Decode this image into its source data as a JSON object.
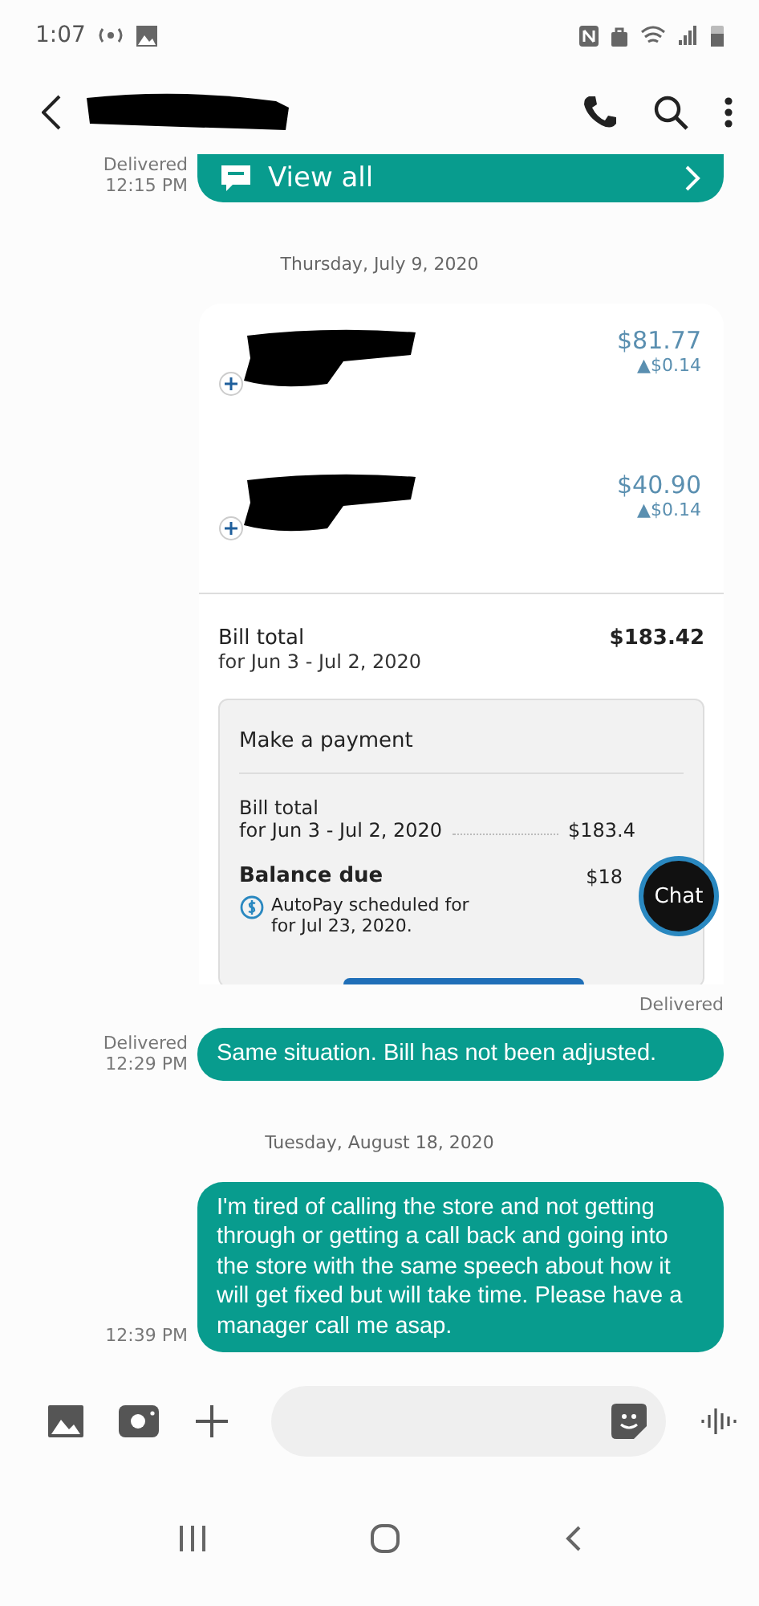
{
  "status_bar": {
    "time": "1:07"
  },
  "messages": [
    {
      "kind": "link",
      "label": "View all",
      "status": "Delivered",
      "time": "12:15 PM"
    },
    {
      "kind": "date",
      "text": "Thursday, July 9, 2020"
    },
    {
      "kind": "bill",
      "lines": [
        {
          "amount": "$81.77",
          "change": "▲$0.14"
        },
        {
          "amount": "$40.90",
          "change": "▲$0.14"
        }
      ],
      "total": {
        "label": "Bill total",
        "period": "for Jun 3 - Jul 2, 2020",
        "amount": "$183.42"
      },
      "payment": {
        "title": "Make a payment",
        "bill_label": "Bill total",
        "bill_period": "for Jun 3 - Jul 2, 2020",
        "bill_amount": "$183.4",
        "balance_label": "Balance due",
        "balance_amount": "$18",
        "autopay_lines": [
          "AutoPay scheduled for",
          "for Jul 23, 2020."
        ]
      },
      "status": "Delivered"
    },
    {
      "kind": "text",
      "text": "Same situation. Bill has not been adjusted.",
      "status": "Delivered",
      "time": "12:29 PM"
    },
    {
      "kind": "date",
      "text": "Tuesday, August 18, 2020"
    },
    {
      "kind": "text",
      "text": "I'm tired of calling the store and not getting through or getting a call back and going into the store with the same speech about how it will get fixed but will take time. Please have a manager call me asap.",
      "time": "12:39 PM"
    }
  ],
  "chat_button": {
    "label": "Chat"
  }
}
